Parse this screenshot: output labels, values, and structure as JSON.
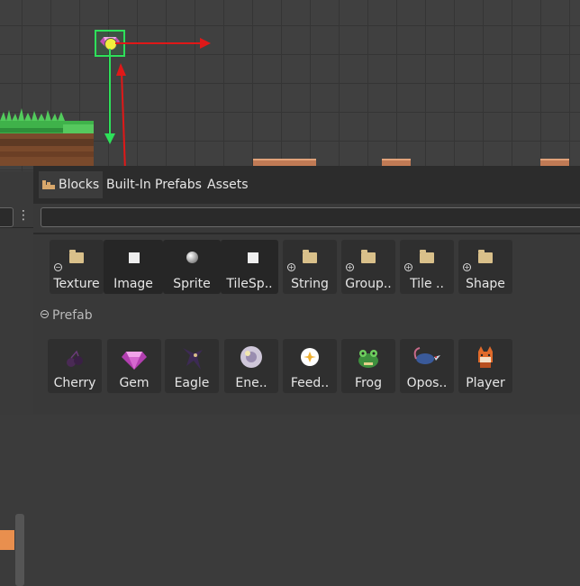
{
  "tabs": [
    {
      "label": "Blocks",
      "active": true
    },
    {
      "label": "Built-In",
      "active": false
    },
    {
      "label": "Prefabs",
      "active": false
    },
    {
      "label": "Assets",
      "active": false
    }
  ],
  "search": {
    "placeholder": ""
  },
  "blocks": [
    {
      "label": "Texture",
      "icon": "folder-icon",
      "collapsible": true
    },
    {
      "label": "Image",
      "icon": "square-icon",
      "collapsible": false
    },
    {
      "label": "Sprite",
      "icon": "sphere-icon",
      "collapsible": false
    },
    {
      "label": "TileSp..",
      "icon": "square-icon",
      "collapsible": false
    },
    {
      "label": "String",
      "icon": "folder-icon",
      "collapsible": true
    },
    {
      "label": "Group..",
      "icon": "folder-icon",
      "collapsible": true
    },
    {
      "label": "Tile ..",
      "icon": "folder-icon",
      "collapsible": true
    },
    {
      "label": "Shape",
      "icon": "folder-icon",
      "collapsible": true
    }
  ],
  "prefab_section": {
    "title": "Prefab"
  },
  "prefabs": [
    {
      "label": "Cherry",
      "icon": "cherry-icon"
    },
    {
      "label": "Gem",
      "icon": "gem-icon"
    },
    {
      "label": "Eagle",
      "icon": "eagle-icon"
    },
    {
      "label": "Ene..",
      "icon": "enemy-death-icon"
    },
    {
      "label": "Feed..",
      "icon": "feedback-icon"
    },
    {
      "label": "Frog",
      "icon": "frog-icon"
    },
    {
      "label": "Opos..",
      "icon": "opossum-icon"
    },
    {
      "label": "Player",
      "icon": "player-fox-icon"
    }
  ],
  "colors": {
    "selection": "#2ee05a",
    "x_axis": "#e01818",
    "y_axis": "#2ee05a",
    "drag_line": "#e01818"
  }
}
